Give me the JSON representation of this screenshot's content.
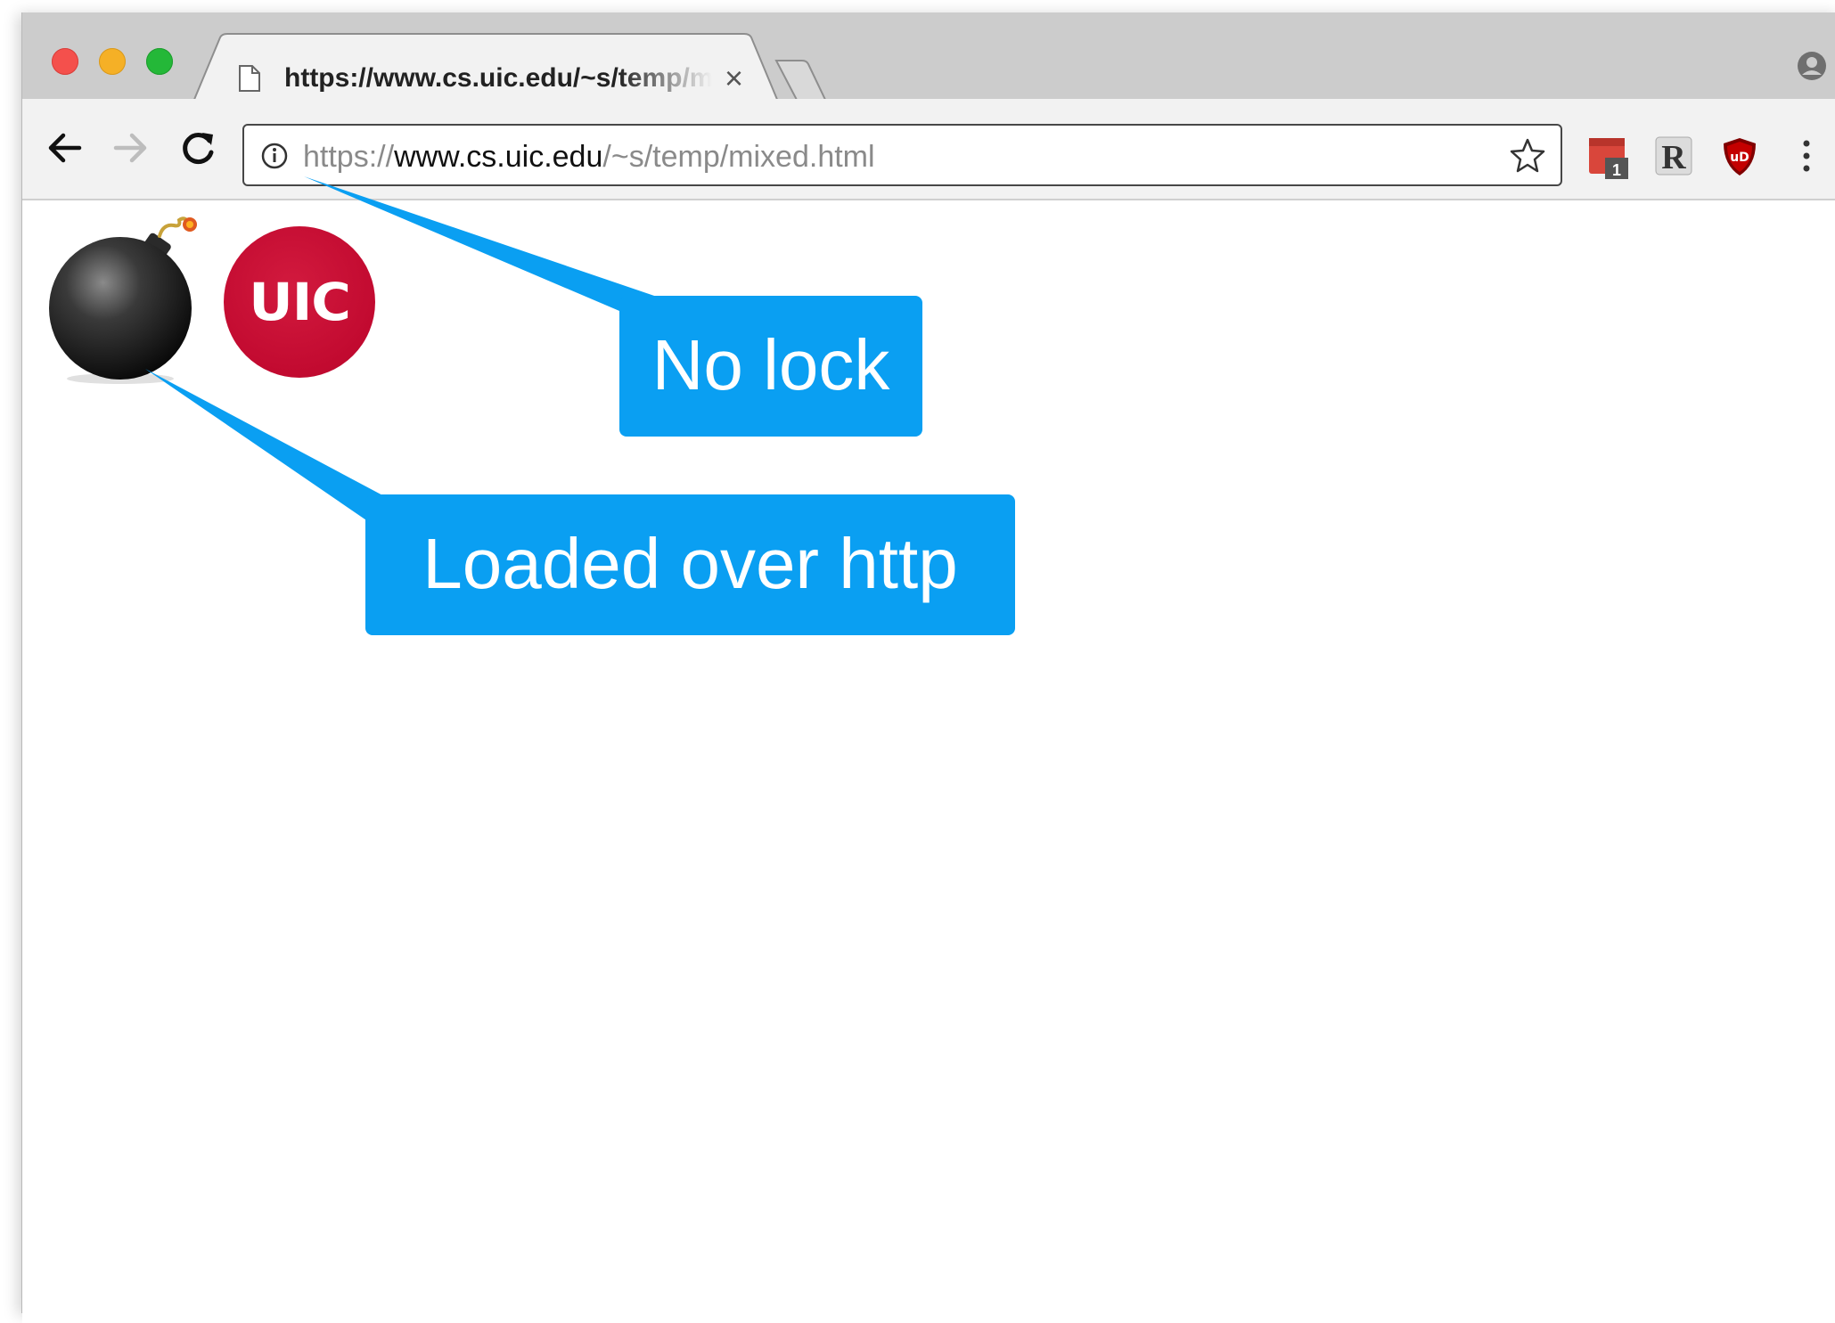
{
  "window": {
    "tab": {
      "title": "https://www.cs.uic.edu/~s/temp/mixed.html",
      "close_glyph": "×",
      "page_icon": "document-icon"
    },
    "traffic_lights": [
      "close",
      "minimize",
      "maximize"
    ],
    "profile_icon": "profile-icon"
  },
  "toolbar": {
    "back_icon": "arrow-back-icon",
    "forward_icon": "arrow-forward-icon",
    "reload_icon": "reload-icon",
    "omnibox": {
      "info_icon": "info-icon",
      "url_scheme": "https://",
      "url_host": "www.cs.uic.edu",
      "url_path": "/~s/temp/mixed.html",
      "bookmark_icon": "star-icon"
    },
    "extensions": [
      {
        "name": "calendar-extension",
        "badge": "1"
      },
      {
        "name": "readability-extension",
        "letter": "R"
      },
      {
        "name": "ublock-extension",
        "letters": "uD"
      }
    ],
    "menu_icon": "kebab-menu-icon"
  },
  "page": {
    "bomb_image": "bomb-icon",
    "uic_logo_text": "UIC"
  },
  "callouts": {
    "no_lock": "No lock",
    "loaded_over_http": "Loaded over http"
  },
  "colors": {
    "callout": "#0a9ff2",
    "uic_red": "#c20a30",
    "tabbar": "#cccccc",
    "toolbar": "#f2f2f2"
  }
}
